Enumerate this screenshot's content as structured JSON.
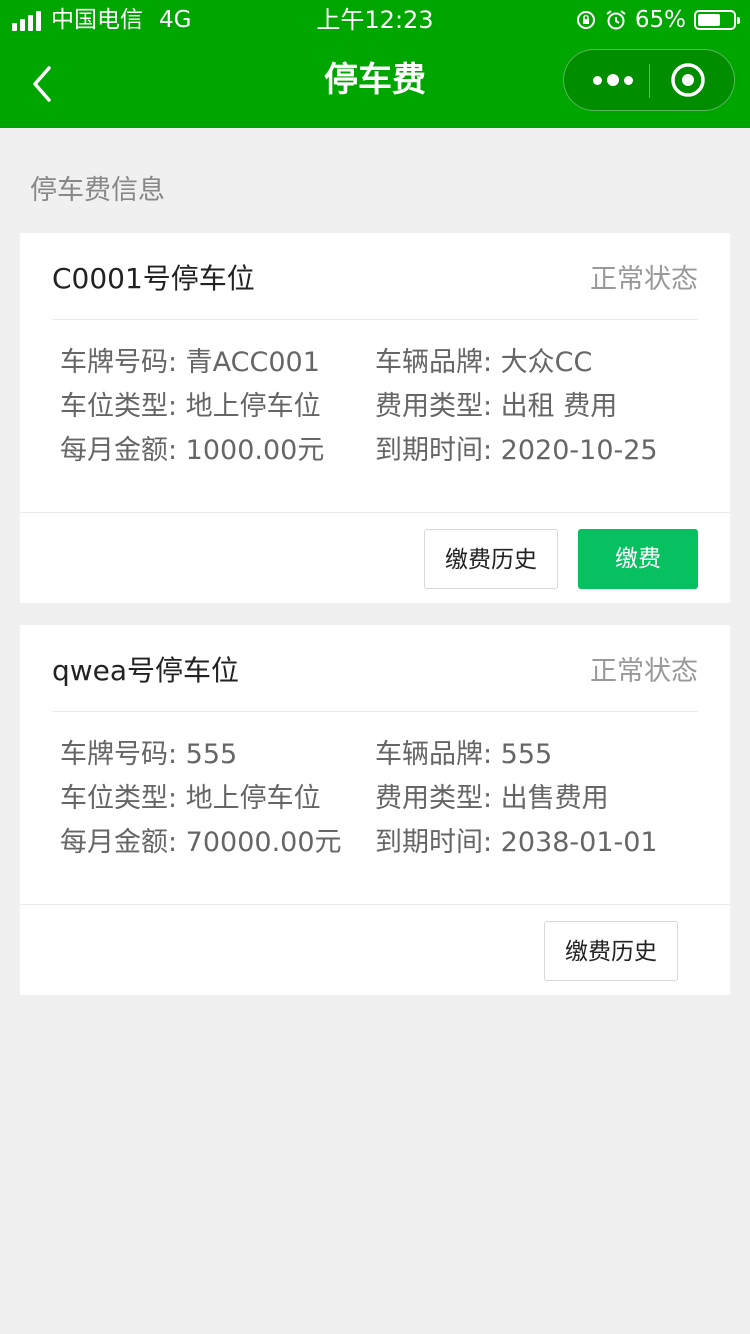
{
  "status_bar": {
    "carrier": "中国电信",
    "network": "4G",
    "time": "上午12:23",
    "battery_percent_label": "65%",
    "battery_level": 0.65
  },
  "nav": {
    "title": "停车费",
    "back_icon": "chevron-left-icon",
    "more_icon": "more-dots-icon",
    "close_icon": "target-circle-icon",
    "bar_color": "#00a600"
  },
  "section": {
    "title": "停车费信息"
  },
  "cards": [
    {
      "title": "C0001号停车位",
      "status": "正常状态",
      "rows": [
        [
          "车牌号码: 青ACC001",
          "车辆品牌: 大众CC"
        ],
        [
          "车位类型: 地上停车位",
          "费用类型: 出租 费用"
        ],
        [
          "每月金额: 1000.00元",
          "到期时间: 2020-10-25"
        ]
      ],
      "history_label": "缴费历史",
      "pay_label": "缴费"
    },
    {
      "title": "qwea号停车位",
      "status": "正常状态",
      "rows": [
        [
          "车牌号码: 555",
          "车辆品牌: 555"
        ],
        [
          "车位类型: 地上停车位",
          "费用类型: 出售费用"
        ],
        [
          "每月金额: 70000.00元",
          "到期时间: 2038-01-01"
        ]
      ],
      "history_label": "缴费历史"
    }
  ],
  "colors": {
    "primary_button": "#07c160",
    "page_background": "#f0f0f0"
  }
}
